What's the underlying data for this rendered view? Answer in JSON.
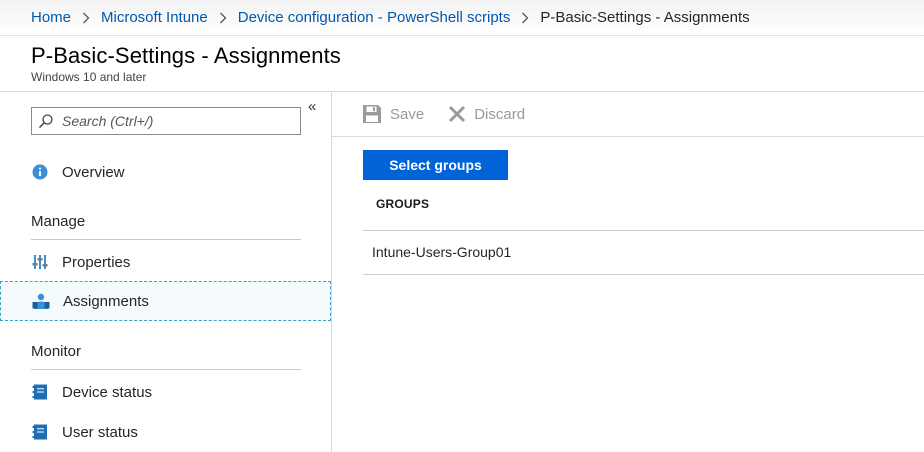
{
  "breadcrumb": {
    "items": [
      "Home",
      "Microsoft Intune",
      "Device configuration - PowerShell scripts"
    ],
    "current": "P-Basic-Settings - Assignments"
  },
  "header": {
    "title": "P-Basic-Settings - Assignments",
    "subtitle": "Windows 10 and later"
  },
  "sidebar": {
    "collapse_glyph": "«",
    "search_placeholder": "Search (Ctrl+/)",
    "overview_label": "Overview",
    "sections": [
      {
        "title": "Manage",
        "items": [
          "Properties",
          "Assignments"
        ]
      },
      {
        "title": "Monitor",
        "items": [
          "Device status",
          "User status"
        ]
      }
    ],
    "selected": "Assignments"
  },
  "toolbar": {
    "save_label": "Save",
    "discard_label": "Discard"
  },
  "main": {
    "select_groups_label": "Select groups",
    "table": {
      "columns": [
        "GROUPS"
      ],
      "rows": [
        [
          "Intune-Users-Group01"
        ]
      ]
    }
  },
  "colors": {
    "accent": "#0063d8",
    "link": "#0058ad",
    "selected_border": "#3ba0c8",
    "disabled": "#9a9a9a"
  }
}
